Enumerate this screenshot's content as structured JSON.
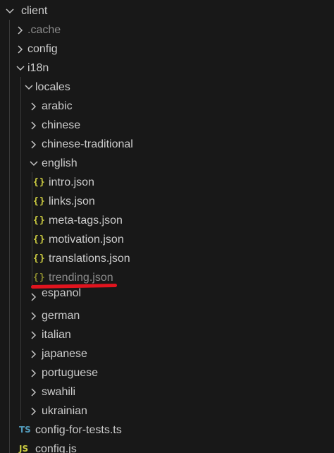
{
  "tree": {
    "client": "client",
    "cache": ".cache",
    "config": "config",
    "i18n": "i18n",
    "locales": "locales",
    "arabic": "arabic",
    "chinese": "chinese",
    "chinese_traditional": "chinese-traditional",
    "english": "english",
    "files": {
      "intro": "intro.json",
      "links": "links.json",
      "meta_tags": "meta-tags.json",
      "motivation": "motivation.json",
      "translations": "translations.json",
      "trending": "trending.json"
    },
    "espanol": "espanol",
    "german": "german",
    "italian": "italian",
    "japanese": "japanese",
    "portuguese": "portuguese",
    "swahili": "swahili",
    "ukrainian": "ukrainian",
    "config_for_tests": "config-for-tests.ts",
    "config_js": "config.js"
  },
  "icons": {
    "json": "{}",
    "ts": "TS",
    "js": "JS"
  },
  "colors": {
    "background": "#181818",
    "text": "#cccccc",
    "json_icon": "#cbcb41",
    "ts_icon": "#519aba",
    "underline": "#e0141e"
  }
}
